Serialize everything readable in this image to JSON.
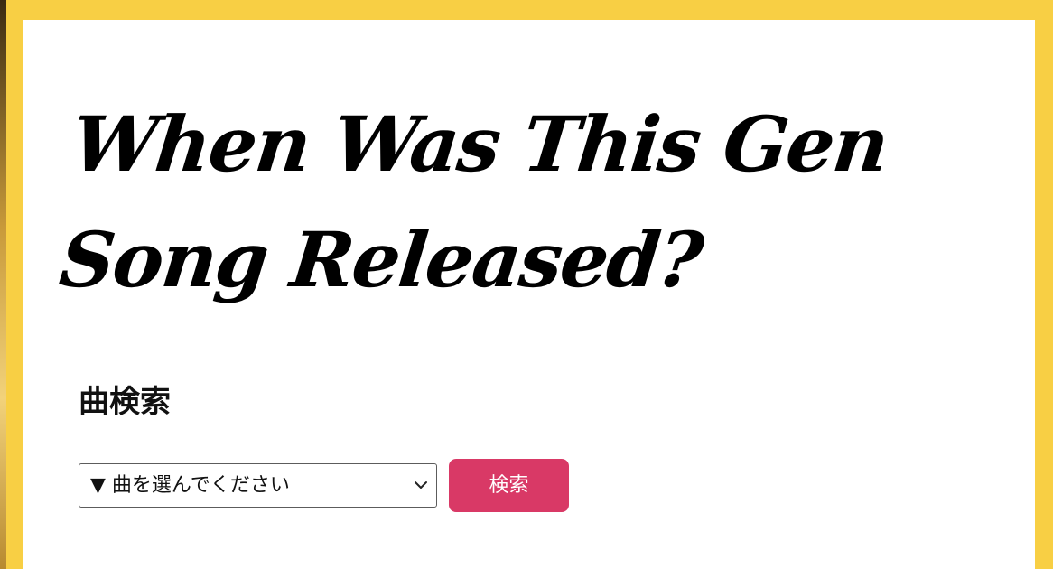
{
  "page": {
    "title_line1": "When Was This Gen",
    "title_line2": "Song Released?",
    "section_heading": "曲検索"
  },
  "search": {
    "select_value": "▼ 曲を選んでください",
    "button_label": "検索"
  },
  "icons": {
    "select_chevron": "chevron-down-icon"
  },
  "colors": {
    "frame": "#F8CF44",
    "card": "#FFFFFF",
    "button": "#D93966",
    "text": "#000000"
  }
}
